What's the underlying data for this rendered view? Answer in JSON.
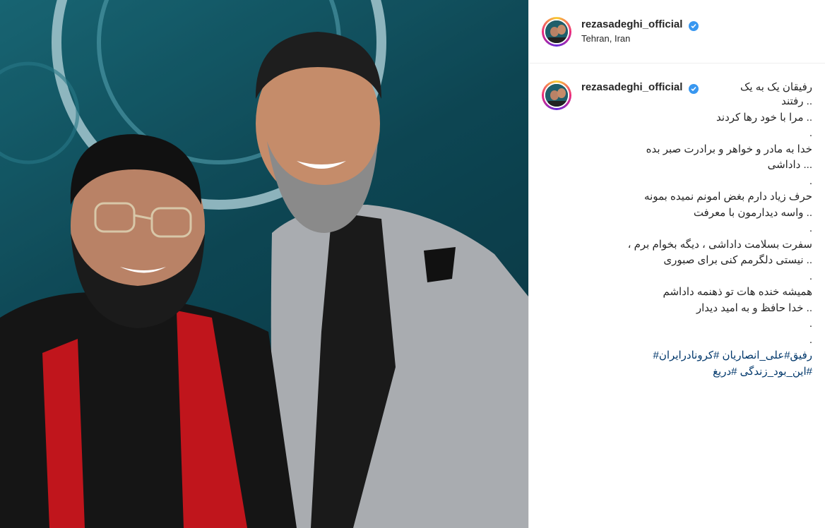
{
  "post": {
    "username": "rezasadeghi_official",
    "location": "Tehran, Iran",
    "verified_icon": "verified-badge-icon",
    "image_icon": "post-photo",
    "colors": {
      "verified_blue": "#3897f0",
      "hashtag_blue": "#00376b",
      "story_ring_start": "#f9ce34",
      "story_ring_end": "#6228d7"
    }
  },
  "caption": {
    "username": "rezasadeghi_official",
    "first_line": "رفیقان یک به یک",
    "lines": [
      ".. رفتند",
      ".. مرا با خود رها کردند",
      ".",
      "خدا به مادر و خواهر و برادرت صبر بده",
      "... داداشی",
      ".",
      "حرف زیاد دارم بغض امونم نمیده بمونه",
      ".. واسه دیدارمون با معرفت",
      ".",
      "سفرت بسلامت داداشی ، دیگه بخوام برم ،",
      ".. نیستی دلگرمم کنی برای صبوری",
      ".",
      "همیشه خنده هات تو ذهنمه داداشم",
      ".. خدا حافظ و به امید دیدار",
      ".",
      "."
    ],
    "hashtag_line_1": "رفیق#علی_انصاریان #کرونادرایران#",
    "hashtag_line_2": "#این_بود_زندگی #دریغ"
  }
}
